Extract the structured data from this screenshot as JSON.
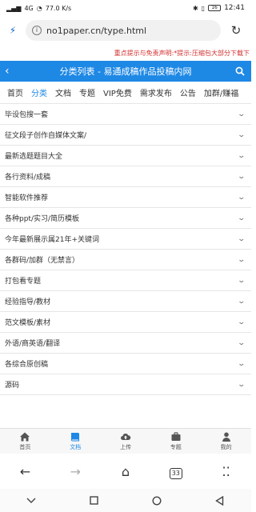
{
  "statusbar": {
    "signal_text": "4G",
    "speed": "77.0 K/s",
    "battery": "16",
    "time": "12:41"
  },
  "browser": {
    "url": "no1paper.cn/type.html"
  },
  "notice": "重点提示与免责声明:*提示:压缩包大部分下载下",
  "header": {
    "title": "分类列表 - 易通成稿作品投稿内网"
  },
  "nav_tabs": [
    "首页",
    "分类",
    "文档",
    "专题",
    "VIP免费",
    "需求发布",
    "公告",
    "加群/赚福"
  ],
  "categories": [
    "毕设包搜一套",
    "征文段子创作自媒体文案/",
    "最新选题题目大全",
    "各行资料/成稿",
    "智能软件推荐",
    "各种ppt/实习/简历模板",
    "今年最新展示属21年+关键词",
    "各群码/加群（无禁言）",
    "打包看专题",
    "经验指导/教材",
    "范文模板/素材",
    "外语/商英语/翻译",
    "各综合原创稿",
    "源码"
  ],
  "bottom_nav": [
    {
      "label": "首页",
      "icon": "home-icon"
    },
    {
      "label": "文档",
      "icon": "book-icon"
    },
    {
      "label": "上传",
      "icon": "cloud-upload-icon"
    },
    {
      "label": "专题",
      "icon": "briefcase-icon"
    },
    {
      "label": "我的",
      "icon": "user-icon"
    }
  ],
  "browser_nav": {
    "tab_count": "33"
  },
  "colors": {
    "accent": "#1e88e5",
    "notice": "#d32f2f"
  }
}
